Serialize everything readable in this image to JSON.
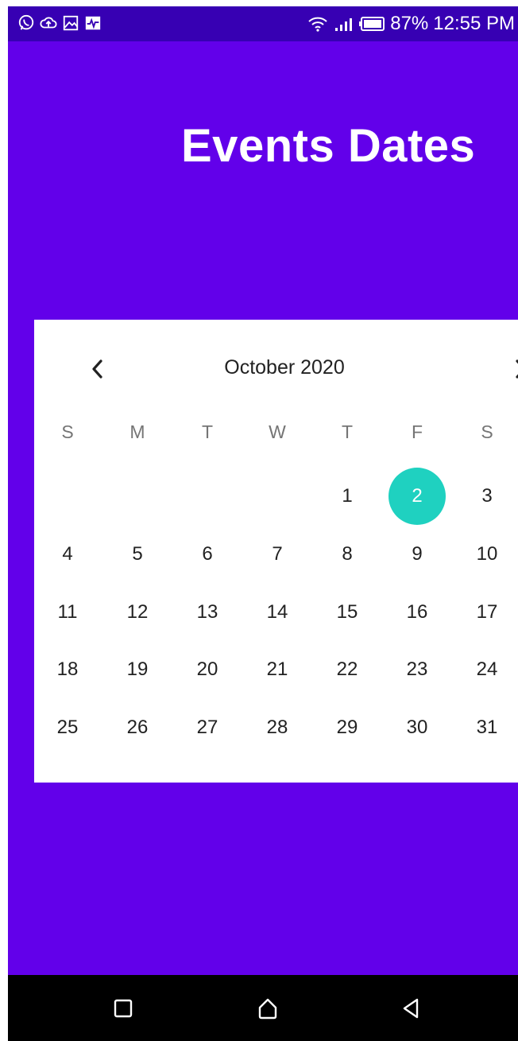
{
  "colors": {
    "background": "#6200ea",
    "status_bar": "#3700b3",
    "selected_day": "#1fd1c0",
    "card": "#ffffff",
    "nav_bar": "#000000"
  },
  "status_bar": {
    "left_icons": [
      "whatsapp-icon",
      "cloud-upload-icon",
      "gallery-icon",
      "activity-icon"
    ],
    "right_icons": [
      "wifi-icon",
      "signal-icon",
      "battery-icon"
    ],
    "battery": "87%",
    "time": "12:55 PM"
  },
  "header": {
    "title": "Events Dates"
  },
  "calendar": {
    "month_label": "October 2020",
    "prev_icon": "chevron-left-icon",
    "next_icon": "chevron-right-icon",
    "weekdays": [
      "S",
      "M",
      "T",
      "W",
      "T",
      "F",
      "S"
    ],
    "days": [
      "1",
      "2",
      "3",
      "4",
      "5",
      "6",
      "7",
      "8",
      "9",
      "10",
      "11",
      "12",
      "13",
      "14",
      "15",
      "16",
      "17",
      "18",
      "19",
      "20",
      "21",
      "22",
      "23",
      "24",
      "25",
      "26",
      "27",
      "28",
      "29",
      "30",
      "31"
    ],
    "first_weekday_index": 4,
    "selected_day": "2"
  },
  "nav_bar": {
    "icons": [
      "recent-apps-icon",
      "home-icon",
      "back-icon"
    ]
  }
}
